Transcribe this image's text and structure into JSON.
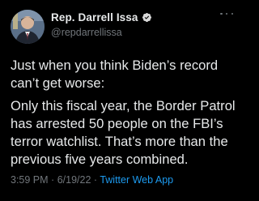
{
  "author": {
    "name": "Rep. Darrell Issa",
    "handle": "@repdarrellissa",
    "verified": true,
    "avatar_icon": "profile-photo"
  },
  "tweet": {
    "paragraphs": [
      {
        "lines": [
          "Just when you think Biden’s record",
          "can’t get worse:"
        ]
      },
      {
        "lines": [
          "Only this fiscal year, the Border Patrol",
          "has arrested 50 people on the FBI’s",
          "terror watchlist. That’s more than the",
          "previous five years combined."
        ]
      }
    ],
    "time": "3:59 PM",
    "separator": "·",
    "date": "6/19/22",
    "source": "Twitter Web App"
  },
  "colors": {
    "background": "#000000",
    "text": "#e7e9ea",
    "secondary": "#71767b",
    "accent": "#1d9bf0"
  },
  "icons": {
    "verified": "verified-badge-icon",
    "more": "more-options-icon"
  }
}
